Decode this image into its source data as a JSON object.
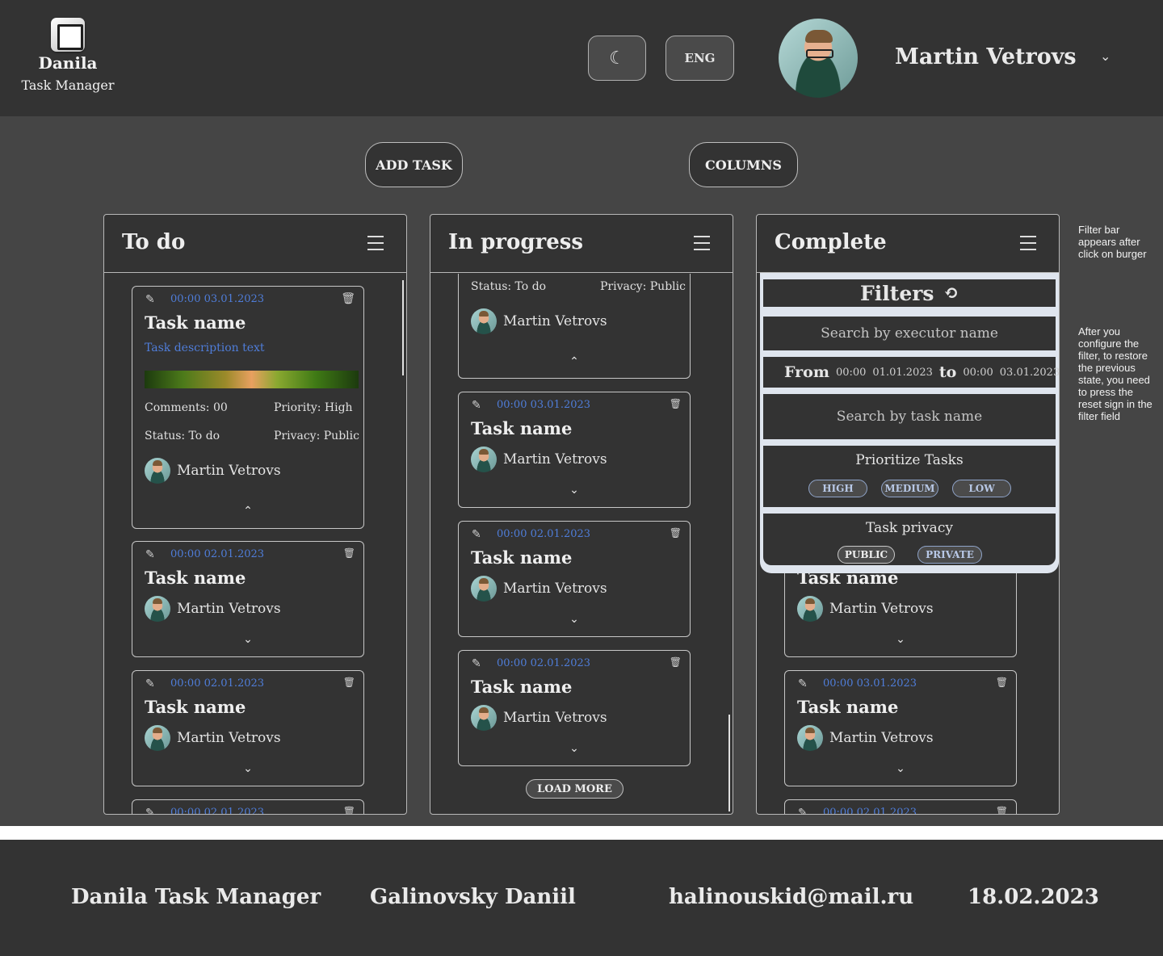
{
  "header": {
    "logo_name": "Danila",
    "logo_subtitle": "Task Manager",
    "theme_icon": "moon-icon",
    "theme_glyph": "☾",
    "lang_label": "ENG",
    "user_name": "Martin Vetrovs",
    "chevron": "⌄"
  },
  "toolbar": {
    "add_task": "ADD TASK",
    "columns": "COLUMNS"
  },
  "columns": [
    {
      "title": "To do",
      "cards": [
        {
          "date": "00:00 03.01.2023",
          "title": "Task name",
          "description": "Task description text",
          "comments": "Comments: 00",
          "priority": "Priority: High",
          "status": "Status: To do",
          "privacy": "Privacy: Public",
          "user": "Martin Vetrovs",
          "toggle": "⌃"
        },
        {
          "date": "00:00 02.01.2023",
          "title": "Task name",
          "user": "Martin Vetrovs",
          "toggle": "⌄"
        },
        {
          "date": "00:00 02.01.2023",
          "title": "Task name",
          "user": "Martin Vetrovs",
          "toggle": "⌄"
        },
        {
          "date": "00:00 02.01.2023"
        }
      ]
    },
    {
      "title": "In progress",
      "cards": [
        {
          "status": "Status: To do",
          "privacy": "Privacy: Public",
          "user": "Martin Vetrovs",
          "toggle": "⌃"
        },
        {
          "date": "00:00 03.01.2023",
          "title": "Task name",
          "user": "Martin Vetrovs",
          "toggle": "⌄"
        },
        {
          "date": "00:00 02.01.2023",
          "title": "Task name",
          "user": "Martin Vetrovs",
          "toggle": "⌄"
        },
        {
          "date": "00:00 02.01.2023",
          "title": "Task name",
          "user": "Martin Vetrovs",
          "toggle": "⌄"
        }
      ],
      "load_more": "LOAD MORE"
    },
    {
      "title": "Complete",
      "cards": [
        {
          "title": "Task name",
          "user": "Martin Vetrovs",
          "toggle": "⌄"
        },
        {
          "date": "00:00 03.01.2023",
          "title": "Task name",
          "user": "Martin Vetrovs",
          "toggle": "⌄"
        },
        {
          "date": "00:00 02.01.2023"
        }
      ],
      "filters": {
        "title": "Filters",
        "reset_glyph": "⟲",
        "executor_placeholder": "Search by executor name",
        "from_label": "From",
        "from_time": "00:00",
        "from_date": "01.01.2023",
        "to_label": "to",
        "to_time": "00:00",
        "to_date": "03.01.2023",
        "task_name_placeholder": "Search by task name",
        "priority_label": "Prioritize Tasks",
        "priority_options": [
          "HIGH",
          "MEDIUM",
          "LOW"
        ],
        "privacy_label": "Task privacy",
        "privacy_options": [
          "PUBLIC",
          "PRIVATE"
        ]
      }
    }
  ],
  "notes": {
    "burger_note": "Filter bar appears after click on burger",
    "reset_note": "After you configure the filter, to restore the previous state, you need to press the reset sign in the filter field"
  },
  "footer": {
    "app_name": "Danila Task Manager",
    "author": "Galinovsky Daniil",
    "email": "halinouskid@mail.ru",
    "date": "18.02.2023"
  },
  "colors": {
    "header_bg": "#333333",
    "page_bg": "#454545",
    "accent_blue": "#4f7dd9",
    "filter_border": "#dfe5ee"
  }
}
